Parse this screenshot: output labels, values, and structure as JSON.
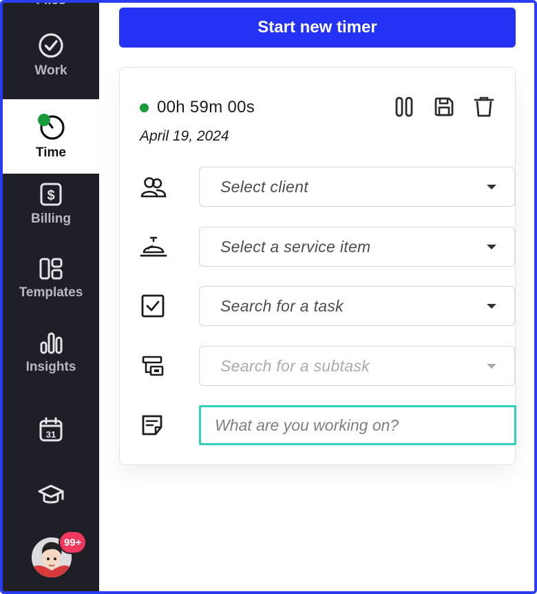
{
  "sidebar": {
    "items": [
      {
        "label": "Files",
        "icon": "files-icon"
      },
      {
        "label": "Work",
        "icon": "check-circle-icon"
      },
      {
        "label": "Time",
        "icon": "timer-icon",
        "active": true
      },
      {
        "label": "Billing",
        "icon": "dollar-icon"
      },
      {
        "label": "Templates",
        "icon": "layout-icon"
      },
      {
        "label": "Insights",
        "icon": "bar-chart-icon"
      },
      {
        "label": "",
        "icon": "calendar-icon",
        "calendar_day": "31"
      },
      {
        "label": "",
        "icon": "graduation-cap-icon"
      }
    ],
    "notification_badge": "99+"
  },
  "main": {
    "start_button_label": "Start new timer",
    "timer": {
      "elapsed": "00h 59m 00s",
      "date": "April 19, 2024",
      "status_color": "#1a9b3b"
    },
    "fields": {
      "client_placeholder": "Select client",
      "service_placeholder": "Select a service item",
      "task_placeholder": "Search for a task",
      "subtask_placeholder": "Search for a subtask",
      "note_placeholder": "What are you working on?"
    }
  },
  "colors": {
    "accent": "#2332f5",
    "sidebar_bg": "#1f1f27",
    "badge": "#f0385f",
    "focus_border": "#2fd1b9"
  }
}
